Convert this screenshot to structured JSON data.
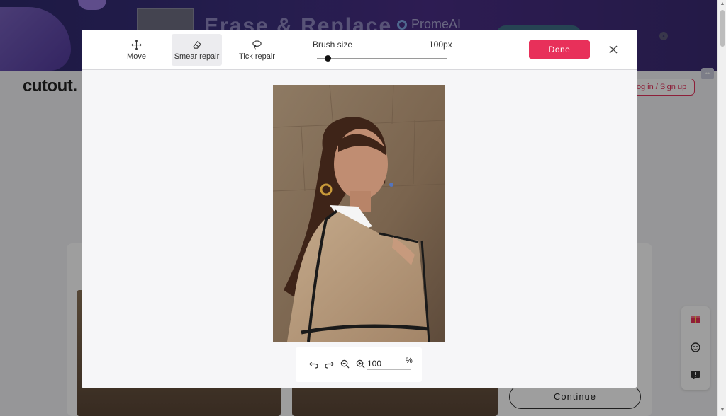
{
  "banner": {
    "title": "Erase & Replace",
    "brand": "PromeAI",
    "close_glyph": "×"
  },
  "site": {
    "logo": "cutout.",
    "login_label": "Log in / Sign up",
    "continue_label": "Continue"
  },
  "sidebar_icons": [
    "gift-icon",
    "support-agent-icon",
    "feedback-icon"
  ],
  "editor": {
    "tools": [
      {
        "label": "Move",
        "icon": "move-arrows-icon",
        "active": false
      },
      {
        "label": "Smear repair",
        "icon": "eraser-icon",
        "active": true
      },
      {
        "label": "Tick repair",
        "icon": "lasso-icon",
        "active": false
      }
    ],
    "brush": {
      "label": "Brush size",
      "value_text": "100px",
      "slider_fraction": 0.08
    },
    "done_label": "Done",
    "close_icon": "close-icon",
    "accent_color": "#e8305a"
  },
  "zoom": {
    "value": "100",
    "unit": "%",
    "icons": [
      "undo-icon",
      "redo-icon",
      "zoom-out-icon",
      "zoom-in-icon"
    ]
  }
}
